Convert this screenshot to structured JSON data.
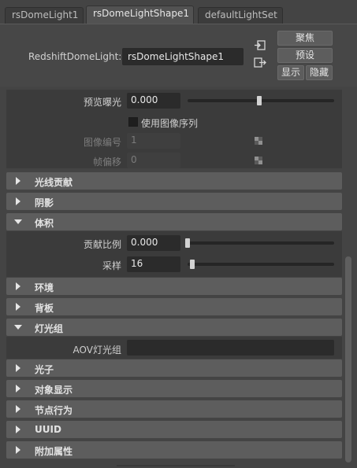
{
  "tabs": [
    {
      "label": "rsDomeLight1",
      "active": false
    },
    {
      "label": "rsDomeLightShape1",
      "active": true
    },
    {
      "label": "defaultLightSet",
      "active": false
    }
  ],
  "header": {
    "node_label": "RedshiftDomeLight:",
    "node_value": "rsDomeLightShape1",
    "buttons": {
      "focus": "聚焦",
      "preset": "预设",
      "show": "显示",
      "hide": "隐藏"
    },
    "icons": [
      "input-connection-icon",
      "output-connection-icon"
    ]
  },
  "image_section": {
    "preview_exposure": {
      "label": "预览曝光",
      "value": "0.000",
      "slider_fraction": 0.5
    },
    "use_image_sequence": {
      "label": "使用图像序列",
      "checked": false
    },
    "image_number": {
      "label": "图像编号",
      "value": "1"
    },
    "frame_offset": {
      "label": "帧偏移",
      "value": "0"
    }
  },
  "frames": {
    "light_contrib": {
      "title": "光线贡献",
      "expanded": false
    },
    "shadow": {
      "title": "阴影",
      "expanded": false
    },
    "volume": {
      "title": "体积",
      "expanded": true
    },
    "environment": {
      "title": "环境",
      "expanded": false
    },
    "backplate": {
      "title": "背板",
      "expanded": false
    },
    "light_group": {
      "title": "灯光组",
      "expanded": true
    },
    "photon": {
      "title": "光子",
      "expanded": false
    },
    "object_display": {
      "title": "对象显示",
      "expanded": false
    },
    "node_behavior": {
      "title": "节点行为",
      "expanded": false
    },
    "uuid": {
      "title": "UUID",
      "expanded": false
    },
    "extra_attrs": {
      "title": "附加属性",
      "expanded": false
    }
  },
  "volume": {
    "contribution_scale": {
      "label": "贡献比例",
      "value": "0.000",
      "slider_fraction": 0.0
    },
    "samples": {
      "label": "采样",
      "value": "16",
      "slider_fraction": 0.03
    }
  },
  "light_group": {
    "aov_light_group": {
      "label": "AOV灯光组",
      "value": ""
    }
  },
  "colors": {
    "background": "#444444",
    "frame_header": "#5d5d5d",
    "section_body": "#3b3b3b",
    "field": "#2b2b2b",
    "active_tab": "#525252"
  }
}
